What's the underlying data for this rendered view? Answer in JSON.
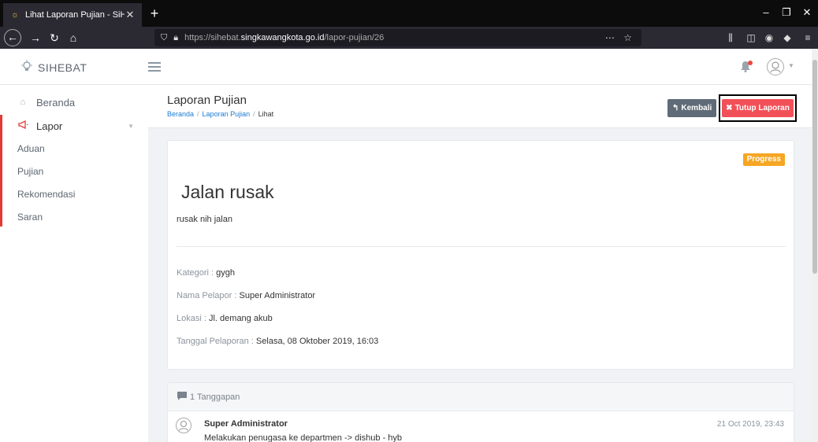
{
  "browser": {
    "tab_title": "Lihat Laporan Pujian - SiHebat",
    "url_prefix": "https://sihebat.",
    "url_host": "singkawangkota.go.id",
    "url_path": "/lapor-pujian/26"
  },
  "app": {
    "brand": "SIHEBAT"
  },
  "sidebar": {
    "items": [
      {
        "label": "Beranda",
        "icon": "home-icon"
      },
      {
        "label": "Lapor",
        "icon": "megaphone-icon"
      }
    ],
    "sub_items": [
      {
        "label": "Aduan"
      },
      {
        "label": "Pujian"
      },
      {
        "label": "Rekomendasi"
      },
      {
        "label": "Saran"
      }
    ]
  },
  "page": {
    "title": "Laporan Pujian",
    "breadcrumb": [
      "Beranda",
      "Laporan Pujian",
      "Lihat"
    ],
    "back_label": "Kembali",
    "close_label": "Tutup Laporan"
  },
  "report": {
    "status": "Progress",
    "title": "Jalan rusak",
    "description": "rusak nih jalan",
    "category_label": "Kategori :",
    "category": "gygh",
    "reporter_label": "Nama Pelapor :",
    "reporter": "Super Administrator",
    "location_label": "Lokasi :",
    "location": "Jl. demang akub",
    "date_label": "Tanggal Pelaporan :",
    "date": "Selasa, 08 Oktober 2019, 16:03"
  },
  "comments": {
    "header": "1 Tanggapan",
    "items": [
      {
        "author": "Super Administrator",
        "date": "21 Oct 2019, 23:43",
        "text": "Melakukan penugasa ke departmen -> dishub - hyb"
      }
    ]
  },
  "colors": {
    "accent_red": "#f25058",
    "badge_orange": "#f6a623",
    "link_blue": "#1a7ad4",
    "back_gray": "#5f6b76"
  }
}
